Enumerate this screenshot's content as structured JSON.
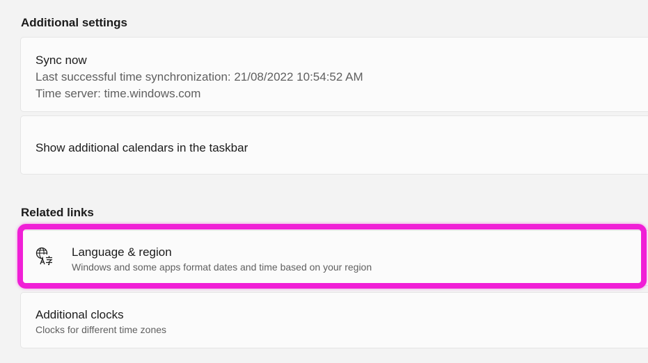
{
  "additional_settings": {
    "title": "Additional settings",
    "sync": {
      "label": "Sync now",
      "last_sync": "Last successful time synchronization: 21/08/2022 10:54:52 AM",
      "time_server": "Time server: time.windows.com"
    },
    "calendars": {
      "label": "Show additional calendars in the taskbar"
    }
  },
  "related_links": {
    "title": "Related links",
    "language_region": {
      "icon": "language-icon",
      "label": "Language & region",
      "description": "Windows and some apps format dates and time based on your region"
    },
    "additional_clocks": {
      "label": "Additional clocks",
      "description": "Clocks for different time zones"
    }
  },
  "colors": {
    "highlight": "#f01fd6",
    "background": "#f3f3f3",
    "card": "#fbfbfb"
  }
}
